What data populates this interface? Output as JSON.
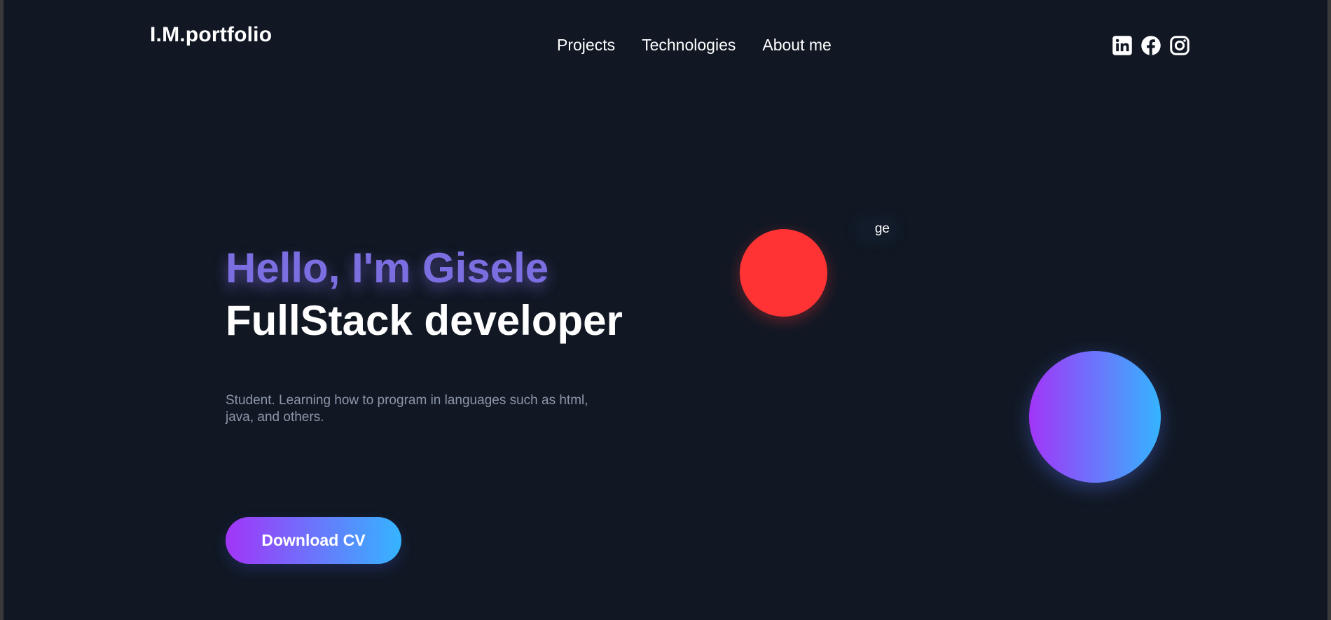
{
  "brand": {
    "logo": "I.M.portfolio"
  },
  "nav": {
    "items": [
      {
        "label": "Projects"
      },
      {
        "label": "Technologies"
      },
      {
        "label": "About me"
      }
    ]
  },
  "socials": [
    {
      "icon": "linkedin-icon"
    },
    {
      "icon": "facebook-icon"
    },
    {
      "icon": "instagram-icon"
    }
  ],
  "hero": {
    "greeting": "Hello, I'm Gisele",
    "role": "FullStack developer",
    "description": "Student. Learning how to program in languages such as html, java, and others.",
    "cta_label": "Download CV",
    "partial_image_text": "ge"
  },
  "colors": {
    "background": "#111824",
    "accent_purple": "#7b6ee0",
    "gradient_start": "#a235f8",
    "gradient_end": "#35b4ff",
    "red_ball": "#ff3333",
    "muted_text": "#8c96a8"
  }
}
